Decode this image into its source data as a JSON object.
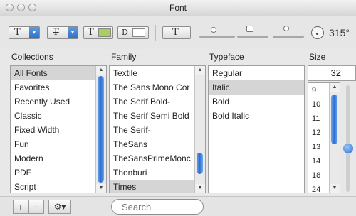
{
  "window": {
    "title": "Font"
  },
  "toolbar": {
    "underline_glyph": "T",
    "strike_glyph": "T",
    "text_color_glyph": "T",
    "doc_color_glyph": "D",
    "shadow_glyph": "T",
    "angle_value": "315°",
    "text_color_swatch": "#a6d160",
    "doc_color_swatch": "#ffffff",
    "arrow_glyph": "▾"
  },
  "headers": {
    "collections": "Collections",
    "family": "Family",
    "typeface": "Typeface",
    "size": "Size"
  },
  "collections": [
    "All Fonts",
    "Favorites",
    "Recently Used",
    "Classic",
    "Fixed Width",
    "Fun",
    "Modern",
    "PDF",
    "Script"
  ],
  "families": [
    "Textile",
    "The Sans Mono Cor",
    "The Serif Bold-",
    "The Serif Semi Bold",
    "The Serif-",
    "TheSans",
    "TheSansPrimeMonc",
    "Thonburi",
    "Times"
  ],
  "typefaces": [
    "Regular",
    "Italic",
    "Bold",
    "Bold Italic"
  ],
  "size": {
    "value": "32",
    "list": [
      "9",
      "10",
      "11",
      "12",
      "13",
      "14",
      "18",
      "24"
    ]
  },
  "selection": {
    "collection": "All Fonts",
    "family": "Times",
    "typeface": "Italic"
  },
  "bottom": {
    "add_label": "+",
    "remove_label": "−",
    "action_label": "⚙▾",
    "search_placeholder": "Search"
  },
  "scroll": {
    "up_arrow": "▲",
    "down_arrow": "▼"
  },
  "colors": {
    "accent": "#2f6ed0",
    "selection": "#d5d5d5"
  }
}
